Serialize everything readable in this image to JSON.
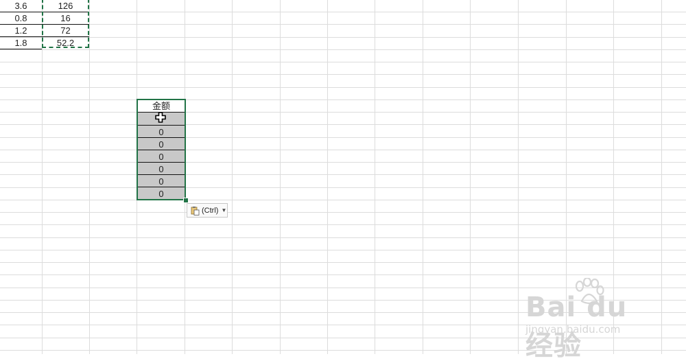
{
  "copied_range": {
    "rows": [
      {
        "col_a": "3.6",
        "col_b": "126"
      },
      {
        "col_a": "0.8",
        "col_b": "16"
      },
      {
        "col_a": "1.2",
        "col_b": "72"
      },
      {
        "col_a": "1.8",
        "col_b": "52.2"
      }
    ]
  },
  "pasted_range": {
    "header": "金额",
    "values": [
      "",
      "0",
      "0",
      "0",
      "0",
      "0",
      "0"
    ]
  },
  "paste_options": {
    "label": "(Ctrl)",
    "icon": "clipboard-paste-icon",
    "dropdown_icon": "dropdown-arrow-icon"
  },
  "cursor": {
    "icon": "cell-select-cross-cursor"
  },
  "watermark": {
    "brand": "Bai du 经验",
    "url": "jingyan.baidu.com"
  },
  "colors": {
    "selection_border": "#217346",
    "selected_fill": "#c8c8c8",
    "gridline": "#dcdcdc",
    "watermark": "#d6d6d6"
  }
}
